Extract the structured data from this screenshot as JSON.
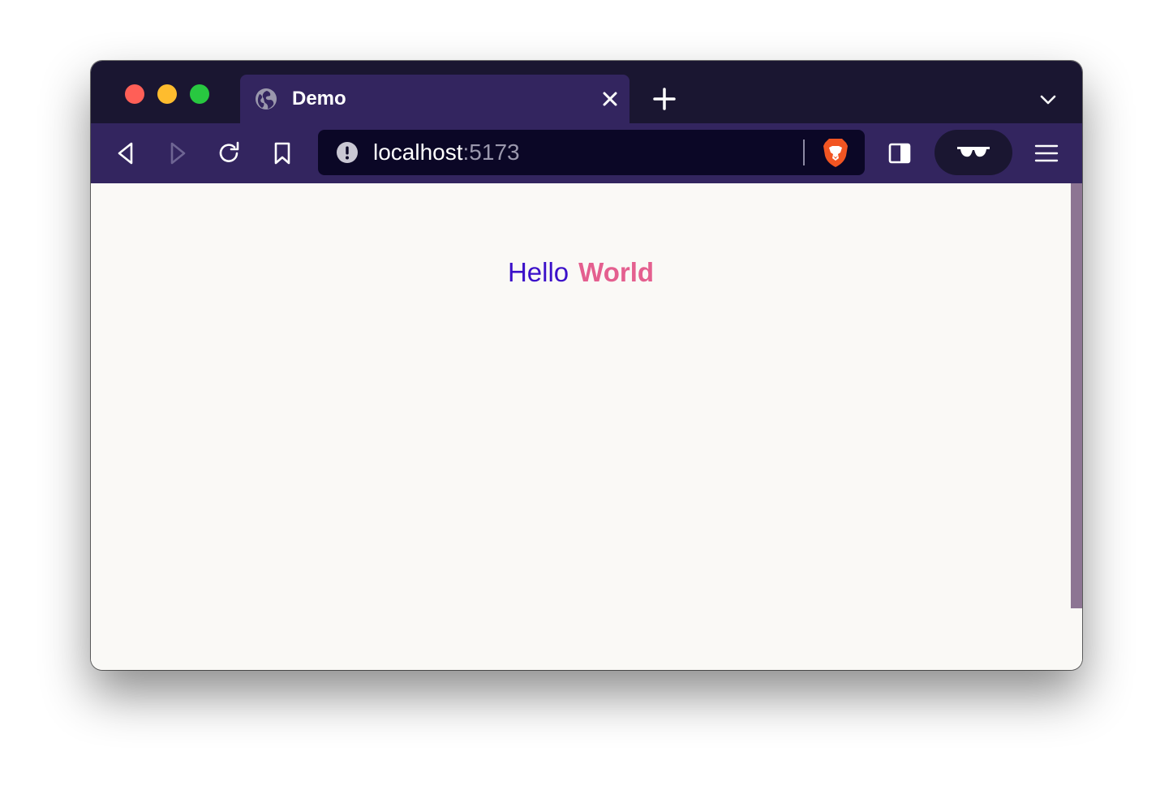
{
  "window": {
    "controls": [
      "close",
      "minimize",
      "zoom"
    ]
  },
  "tabs": [
    {
      "title": "Demo",
      "icon": "globe-icon",
      "active": true
    }
  ],
  "toolbar": {
    "back_icon": "back-arrow-icon",
    "forward_icon": "forward-arrow-icon",
    "reload_icon": "reload-icon",
    "bookmark_icon": "bookmark-icon",
    "address": {
      "host": "localhost",
      "port": ":5173",
      "security_icon": "info-warning-icon"
    },
    "shields_icon": "brave-lion-icon",
    "sidebar_icon": "sidebar-icon",
    "private_icon": "sunglasses-icon",
    "menu_icon": "hamburger-menu-icon"
  },
  "page": {
    "greeting_first": "Hello",
    "greeting_second": "World"
  },
  "colors": {
    "tabstrip": "#1a1631",
    "toolbar": "#33255f",
    "urlbar": "#0b0726",
    "hello": "#3b10c9",
    "world": "#e45f8f",
    "scrollbar": "#8d7593"
  }
}
